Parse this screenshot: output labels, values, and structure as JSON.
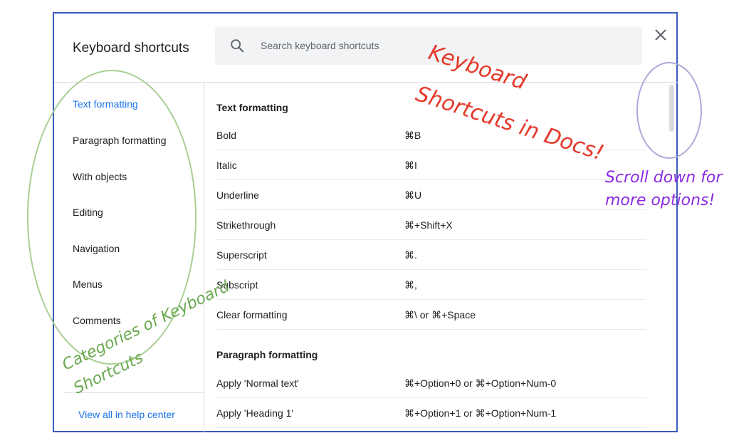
{
  "dialog": {
    "title": "Keyboard shortcuts",
    "search_placeholder": "Search keyboard shortcuts"
  },
  "sidebar": {
    "items": [
      {
        "label": "Text formatting"
      },
      {
        "label": "Paragraph formatting"
      },
      {
        "label": "With objects"
      },
      {
        "label": "Editing"
      },
      {
        "label": "Navigation"
      },
      {
        "label": "Menus"
      },
      {
        "label": "Comments"
      }
    ],
    "help_link": "View all in help center"
  },
  "content": {
    "sections": [
      {
        "title": "Text formatting"
      },
      {
        "title": "Paragraph formatting"
      }
    ],
    "text_formatting": [
      {
        "name": "Bold",
        "keys": "⌘B"
      },
      {
        "name": "Italic",
        "keys": "⌘I"
      },
      {
        "name": "Underline",
        "keys": "⌘U"
      },
      {
        "name": "Strikethrough",
        "keys": "⌘+Shift+X"
      },
      {
        "name": "Superscript",
        "keys": "⌘."
      },
      {
        "name": "Subscript",
        "keys": "⌘,"
      },
      {
        "name": "Clear formatting",
        "keys": "⌘\\ or ⌘+Space"
      }
    ],
    "paragraph_formatting": [
      {
        "name": "Apply 'Normal text'",
        "keys": "⌘+Option+0 or ⌘+Option+Num-0"
      },
      {
        "name": "Apply 'Heading 1'",
        "keys": "⌘+Option+1 or ⌘+Option+Num-1"
      }
    ]
  },
  "annotations": {
    "docs_note": [
      "Keyboard",
      "Shortcuts in Docs!"
    ],
    "scroll_note": [
      "Scroll down for",
      "more options!"
    ],
    "categories_note": [
      "Categories of Keyboard",
      "Shortcuts"
    ]
  },
  "colors": {
    "accent": "#1a73e8",
    "frame_border": "#3a5bb8",
    "annotation_red": "#e5392b",
    "annotation_purple": "#8a2be2",
    "annotation_green": "#6aa84f"
  }
}
